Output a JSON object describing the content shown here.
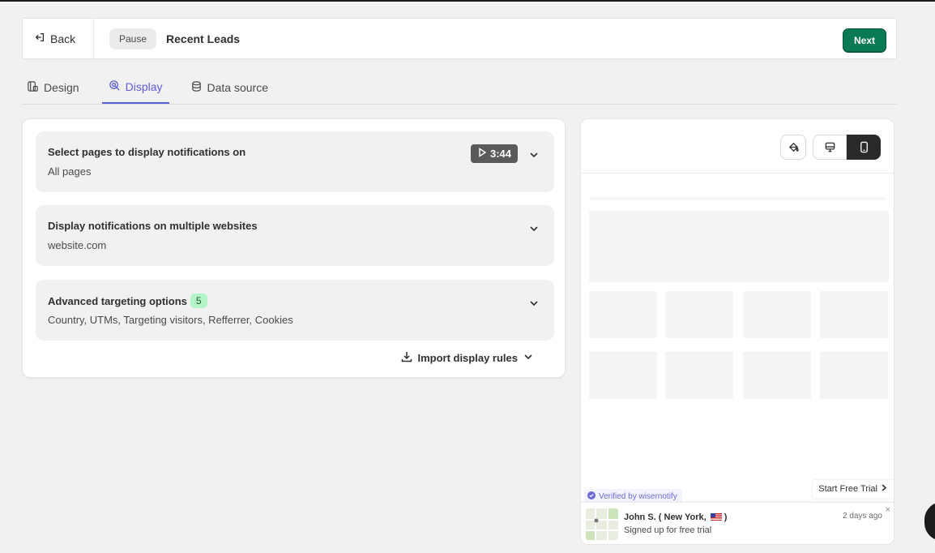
{
  "header": {
    "back_label": "Back",
    "pause_label": "Pause",
    "title": "Recent Leads",
    "next_label": "Next"
  },
  "tabs": [
    {
      "label": "Design",
      "icon": "design-icon",
      "active": false
    },
    {
      "label": "Display",
      "icon": "display-icon",
      "active": true
    },
    {
      "label": "Data source",
      "icon": "database-icon",
      "active": false
    }
  ],
  "sections": [
    {
      "title": "Select pages to display notifications on",
      "subtitle": "All pages",
      "video_duration": "3:44"
    },
    {
      "title": "Display notifications on multiple websites",
      "subtitle": "website.com"
    },
    {
      "title": "Advanced targeting options",
      "badge": "5",
      "subtitle": "Country, UTMs, Targeting visitors, Refferrer, Cookies"
    }
  ],
  "import_rules_label": "Import display rules",
  "preview": {
    "toolbar": [
      "paint-icon",
      "desktop-icon",
      "mobile-icon"
    ],
    "active_device": "mobile",
    "cta_label": "Start Free Trial",
    "verified_label": "Verified by wisernotify",
    "notification": {
      "name": "John S. ( New York,",
      "name_suffix": ")",
      "action": "Signed up for free trial",
      "time": "2 days ago",
      "close": "×"
    }
  },
  "colors": {
    "accent": "#5b5fd6",
    "primary_button": "#0a7a55",
    "badge_green": "#b4f5c7",
    "video_badge": "#5a5a5a"
  }
}
